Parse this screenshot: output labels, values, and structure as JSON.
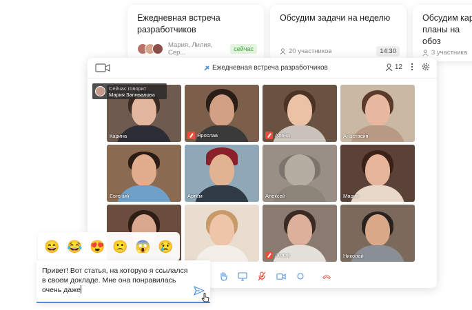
{
  "cards": [
    {
      "title": "Ежедневная встреча разработчиков",
      "participants": "Мария, Лилия, Сер...",
      "badge": "сейчас"
    },
    {
      "title": "Обсудим задачи на неделю",
      "participants": "20 участников",
      "time": "14:30"
    },
    {
      "title": "Обсудим карь планы на обоз",
      "participants": "3 участника"
    }
  ],
  "window": {
    "title": "Ежедневная встреча разработчиков",
    "participant_count": "12"
  },
  "speaker": {
    "label": "Сейчас говорит",
    "name": "Мария Запивалова"
  },
  "tiles": [
    {
      "name": "Карина",
      "muted": false
    },
    {
      "name": "Ярослав",
      "muted": true
    },
    {
      "name": "Алёна",
      "muted": true
    },
    {
      "name": "Анастасия",
      "muted": false
    },
    {
      "name": "Евгений",
      "muted": false
    },
    {
      "name": "Артём",
      "muted": false
    },
    {
      "name": "Алексей",
      "muted": false
    },
    {
      "name": "Мария",
      "muted": false
    },
    {
      "name": "",
      "muted": false
    },
    {
      "name": "",
      "muted": false
    },
    {
      "name": "Лилия",
      "muted": true
    },
    {
      "name": "Николай",
      "muted": false
    }
  ],
  "emojis": [
    "😄",
    "😂",
    "😍",
    "🙁",
    "😱",
    "😢"
  ],
  "chat": {
    "message": "Привет! Вот статья, на которую я ссылался в своем докладе. Мне она понравилась очень даже"
  },
  "colors": {
    "accent": "#4a8fe0",
    "muted": "#e74c3c",
    "now_badge": "#3aa53a"
  }
}
